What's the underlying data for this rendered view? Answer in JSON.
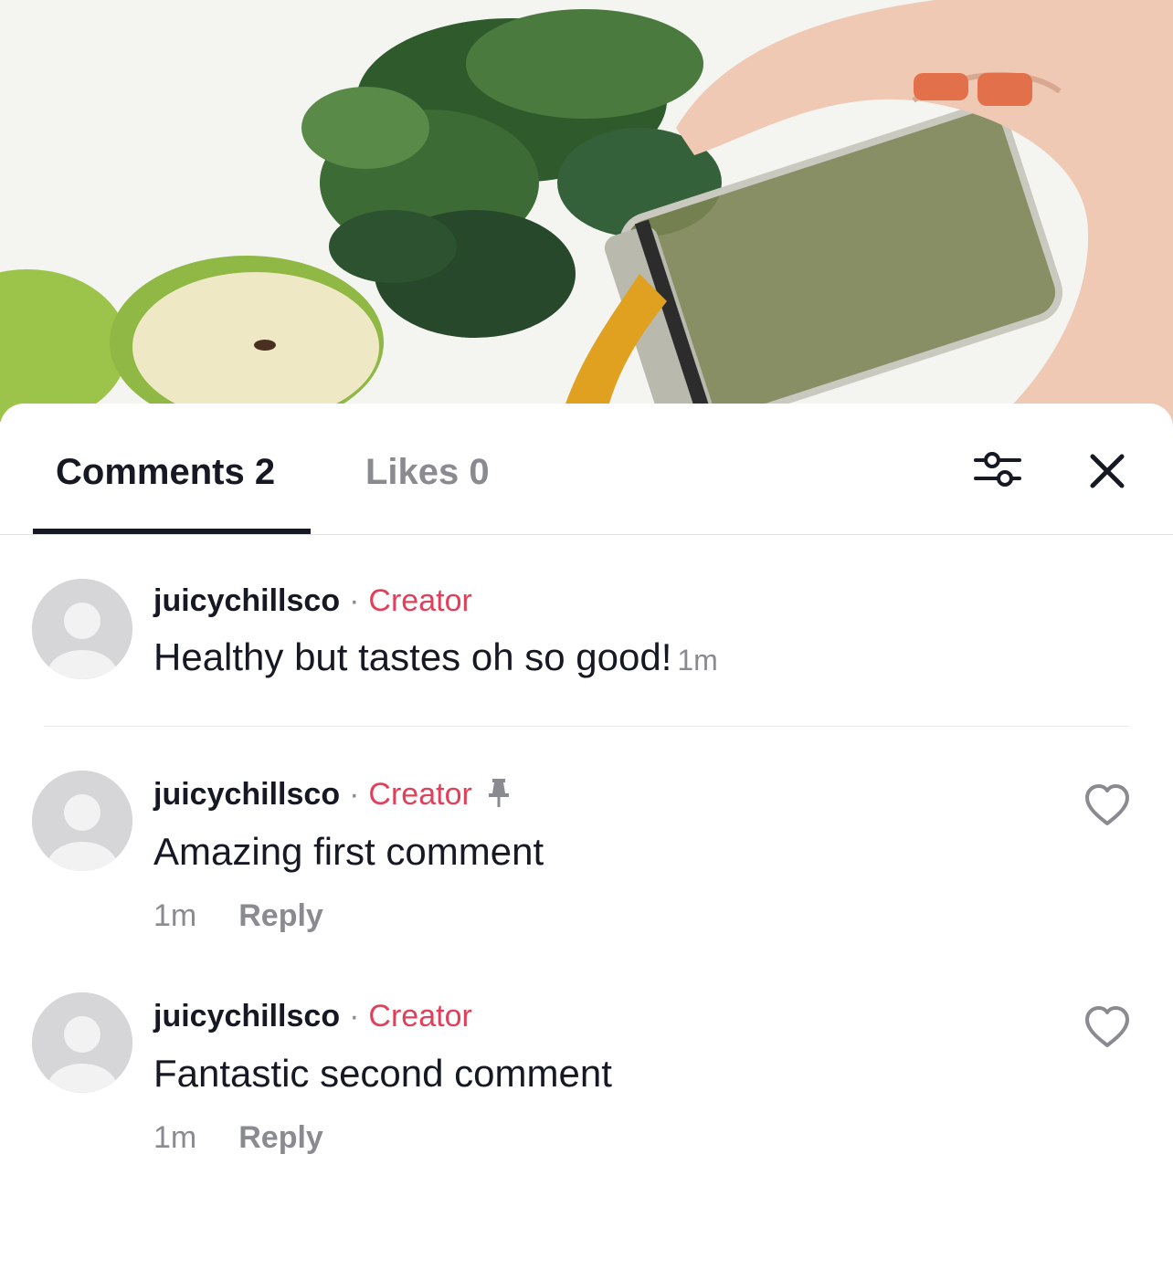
{
  "tabs": {
    "comments_label": "Comments 2",
    "likes_label": "Likes 0"
  },
  "icons": {
    "filter": "sliders-icon",
    "close": "close-icon",
    "pin": "pin-icon",
    "like": "heart-icon",
    "avatar": "default-avatar-icon"
  },
  "colors": {
    "creator_badge": "#e0405a",
    "primary_text": "#161823",
    "secondary_text": "#8a8b91"
  },
  "caption": {
    "username": "juicychillsco",
    "separator": "·",
    "badge": "Creator",
    "text": "Healthy but tastes oh so good!",
    "time": "1m"
  },
  "comments": [
    {
      "username": "juicychillsco",
      "separator": "·",
      "badge": "Creator",
      "pinned": true,
      "text": "Amazing first comment",
      "time": "1m",
      "reply_label": "Reply"
    },
    {
      "username": "juicychillsco",
      "separator": "·",
      "badge": "Creator",
      "pinned": false,
      "text": "Fantastic second comment",
      "time": "1m",
      "reply_label": "Reply"
    }
  ]
}
